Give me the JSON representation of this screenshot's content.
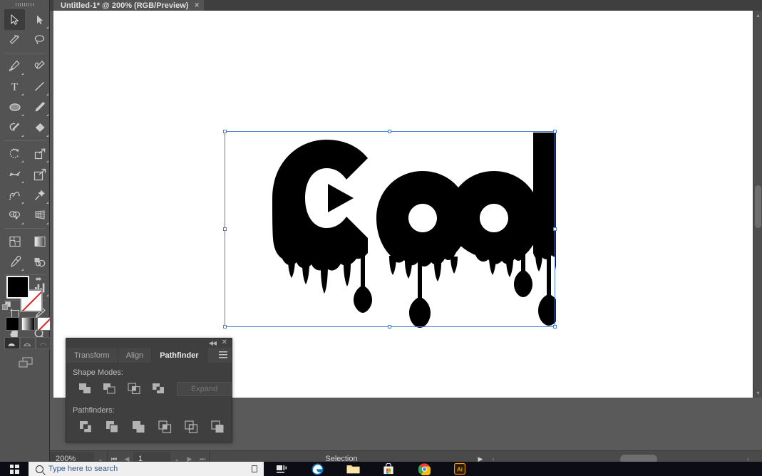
{
  "app": {
    "name": "Adobe Illustrator",
    "document_tab": "Untitled-1* @ 200% (RGB/Preview)",
    "tab_close": "×"
  },
  "toolbar": {
    "tools": [
      {
        "name": "selection-tool",
        "selected": true,
        "has_flyout": false
      },
      {
        "name": "direct-selection-tool",
        "selected": false,
        "has_flyout": true
      },
      {
        "name": "magic-wand-tool",
        "selected": false,
        "has_flyout": false
      },
      {
        "name": "lasso-tool",
        "selected": false,
        "has_flyout": false
      },
      {
        "name": "pen-tool",
        "selected": false,
        "has_flyout": true
      },
      {
        "name": "curvature-tool",
        "selected": false,
        "has_flyout": false
      },
      {
        "name": "type-tool",
        "selected": false,
        "has_flyout": true
      },
      {
        "name": "line-segment-tool",
        "selected": false,
        "has_flyout": true
      },
      {
        "name": "ellipse-tool",
        "selected": false,
        "has_flyout": true
      },
      {
        "name": "paintbrush-tool",
        "selected": false,
        "has_flyout": true
      },
      {
        "name": "shaper-tool",
        "selected": false,
        "has_flyout": true
      },
      {
        "name": "eraser-tool",
        "selected": false,
        "has_flyout": true
      },
      {
        "name": "rotate-tool",
        "selected": false,
        "has_flyout": true
      },
      {
        "name": "scale-tool",
        "selected": false,
        "has_flyout": true
      },
      {
        "name": "width-tool",
        "selected": false,
        "has_flyout": true
      },
      {
        "name": "free-transform-tool",
        "selected": false,
        "has_flyout": false
      },
      {
        "name": "shape-builder-tool",
        "selected": false,
        "has_flyout": true
      },
      {
        "name": "perspective-grid-tool",
        "selected": false,
        "has_flyout": true
      },
      {
        "name": "mesh-tool",
        "selected": false,
        "has_flyout": false
      },
      {
        "name": "gradient-tool",
        "selected": false,
        "has_flyout": false
      },
      {
        "name": "eyedropper-tool",
        "selected": false,
        "has_flyout": true
      },
      {
        "name": "blend-tool",
        "selected": false,
        "has_flyout": false
      },
      {
        "name": "symbol-sprayer-tool",
        "selected": false,
        "has_flyout": true
      },
      {
        "name": "column-graph-tool",
        "selected": false,
        "has_flyout": true
      },
      {
        "name": "artboard-tool",
        "selected": false,
        "has_flyout": false
      },
      {
        "name": "slice-tool",
        "selected": false,
        "has_flyout": true
      },
      {
        "name": "hand-tool",
        "selected": false,
        "has_flyout": true
      },
      {
        "name": "zoom-tool",
        "selected": false,
        "has_flyout": false
      }
    ],
    "fill_color": "#000000",
    "stroke_color": "none",
    "swap_icon": "⬌",
    "color_modes": [
      "solid-color",
      "gradient",
      "none"
    ],
    "draw_modes": [
      "draw-normal",
      "draw-behind",
      "draw-inside"
    ],
    "active_draw_mode": "draw-normal"
  },
  "canvas": {
    "artwork_text": "Cool",
    "artwork_style": "dripping-paint-letters",
    "artwork_fill": "#000000",
    "selection_color": "#4a7fd4",
    "background": "#ffffff",
    "pasteboard": "#5a5a5a"
  },
  "panel": {
    "collapse_icon": "◀◀",
    "close_icon": "✕",
    "tabs": [
      {
        "label": "Transform",
        "active": false
      },
      {
        "label": "Align",
        "active": false
      },
      {
        "label": "Pathfinder",
        "active": true
      }
    ],
    "shape_modes_label": "Shape Modes:",
    "shape_modes": [
      {
        "name": "unite"
      },
      {
        "name": "minus-front"
      },
      {
        "name": "intersect"
      },
      {
        "name": "exclude"
      }
    ],
    "expand_label": "Expand",
    "expand_enabled": false,
    "pathfinders_label": "Pathfinders:",
    "pathfinders": [
      {
        "name": "divide"
      },
      {
        "name": "trim"
      },
      {
        "name": "merge"
      },
      {
        "name": "crop"
      },
      {
        "name": "outline"
      },
      {
        "name": "minus-back"
      }
    ]
  },
  "statusbar": {
    "zoom_level": "200%",
    "zoom_caret": "⌄",
    "first_page_icon": "⏮",
    "prev_page_icon": "◀",
    "page_number": "1",
    "page_caret": "⌄",
    "next_page_icon": "▶",
    "last_page_icon": "⏭",
    "status_text": "Selection",
    "play_icon": "▶",
    "lt_icon": "‹",
    "scroll_right_icon": "›"
  },
  "taskbar": {
    "start_label": "windows-logo",
    "search_placeholder": "Type here to search",
    "items": [
      {
        "name": "task-view-icon"
      },
      {
        "name": "microsoft-edge-icon"
      },
      {
        "name": "file-explorer-icon"
      },
      {
        "name": "microsoft-store-icon"
      },
      {
        "name": "google-chrome-icon"
      },
      {
        "name": "adobe-illustrator-icon"
      }
    ]
  }
}
